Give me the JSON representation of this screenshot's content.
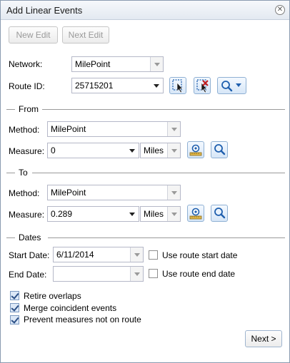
{
  "window": {
    "title": "Add Linear Events"
  },
  "toolbar": {
    "new_edit": "New Edit",
    "next_edit": "Next Edit"
  },
  "network": {
    "label": "Network:",
    "value": "MilePoint"
  },
  "route": {
    "label": "Route ID:",
    "value": "25715201"
  },
  "from": {
    "title": "From",
    "method_label": "Method:",
    "method_value": "MilePoint",
    "measure_label": "Measure:",
    "measure_value": "0",
    "unit": "Miles"
  },
  "to": {
    "title": "To",
    "method_label": "Method:",
    "method_value": "MilePoint",
    "measure_label": "Measure:",
    "measure_value": "0.289",
    "unit": "Miles"
  },
  "dates": {
    "title": "Dates",
    "start_label": "Start Date:",
    "start_value": "6/11/2014",
    "use_start": "Use route start date",
    "end_label": "End Date:",
    "end_value": "",
    "use_end": "Use route end date"
  },
  "options": {
    "retire": "Retire overlaps",
    "merge": "Merge coincident events",
    "prevent": "Prevent measures not on route"
  },
  "footer": {
    "next": "Next >"
  },
  "colors": {
    "accent": "#c42020",
    "icon_blue": "#1f5fae",
    "border": "#8a9bb0"
  }
}
